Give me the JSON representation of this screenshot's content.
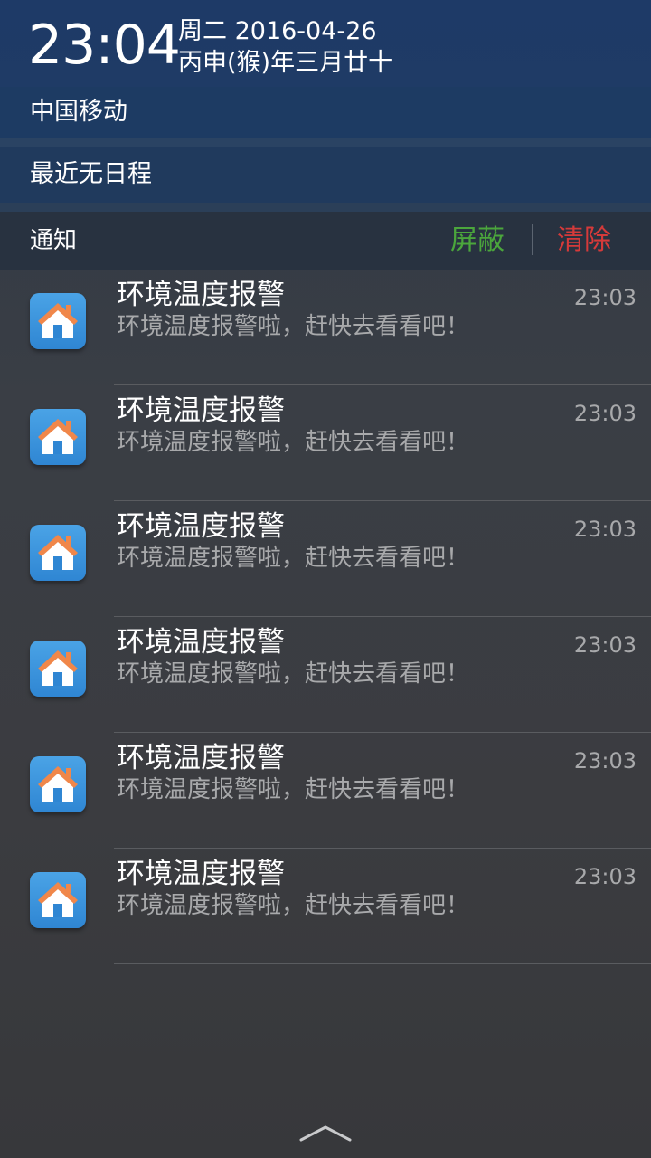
{
  "header": {
    "time": "23:04",
    "date": "周二 2016-04-26",
    "lunar_date": "丙申(猴)年三月廿十"
  },
  "carrier": "中国移动",
  "schedule": "最近无日程",
  "notifications_header": {
    "title": "通知",
    "block_label": "屏蔽",
    "clear_label": "清除"
  },
  "notifications": [
    {
      "icon": "home-icon",
      "title": "环境温度报警",
      "body": "环境温度报警啦，赶快去看看吧！",
      "time": "23:03"
    },
    {
      "icon": "home-icon",
      "title": "环境温度报警",
      "body": "环境温度报警啦，赶快去看看吧！",
      "time": "23:03"
    },
    {
      "icon": "home-icon",
      "title": "环境温度报警",
      "body": "环境温度报警啦，赶快去看看吧！",
      "time": "23:03"
    },
    {
      "icon": "home-icon",
      "title": "环境温度报警",
      "body": "环境温度报警啦，赶快去看看吧！",
      "time": "23:03"
    },
    {
      "icon": "home-icon",
      "title": "环境温度报警",
      "body": "环境温度报警啦，赶快去看看吧！",
      "time": "23:03"
    },
    {
      "icon": "home-icon",
      "title": "环境温度报警",
      "body": "环境温度报警啦，赶快去看看吧！",
      "time": "23:03"
    }
  ],
  "colors": {
    "header_bg": "#1e3a67",
    "block_color": "#4ba63c",
    "clear_color": "#d53a3a",
    "icon_bg": "#3a94dc",
    "roof_color": "#f0874a"
  }
}
